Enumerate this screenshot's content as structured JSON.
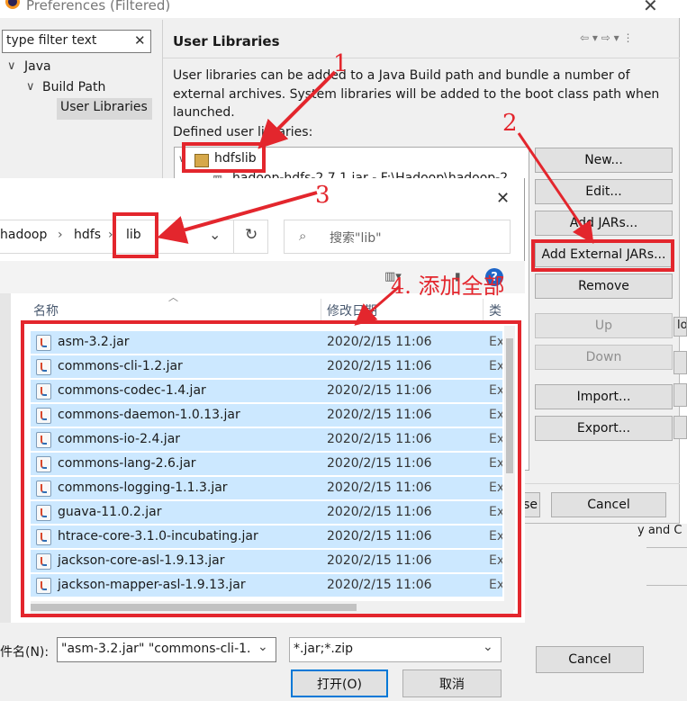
{
  "prefs": {
    "title": "Preferences (Filtered)",
    "filter_placeholder": "type filter text",
    "tree": {
      "java": "Java",
      "build_path": "Build Path",
      "user_libraries": "User Libraries"
    },
    "panel_title": "User Libraries",
    "description": "User libraries can be added to a Java Build path and bundle a number of external archives. System libraries will be added to the boot class path when launched.",
    "defined_label": "Defined user libraries:",
    "library_name": "hdfslib",
    "library_jar": "hadoop-hdfs-2.7.1.jar - F:\\Hadoop\\hadoop-2",
    "buttons": {
      "new": "New...",
      "edit": "Edit...",
      "add_jars": "Add JARs...",
      "add_external_jars": "Add External JARs...",
      "remove": "Remove",
      "up": "Up",
      "down": "Down",
      "import": "Import...",
      "export": "Export...",
      "apply_close_partial": "se",
      "cancel": "Cancel",
      "cancel_bottom": "Cancel"
    }
  },
  "dialog": {
    "breadcrumb": [
      "hadoop",
      "hdfs",
      "lib"
    ],
    "search_placeholder": "搜索\"lib\"",
    "columns": {
      "name": "名称",
      "modified": "修改日期",
      "type": "类"
    },
    "files": [
      {
        "name": "asm-3.2.jar",
        "date": "2020/2/15 11:06",
        "type": "Ex"
      },
      {
        "name": "commons-cli-1.2.jar",
        "date": "2020/2/15 11:06",
        "type": "Ex"
      },
      {
        "name": "commons-codec-1.4.jar",
        "date": "2020/2/15 11:06",
        "type": "Ex"
      },
      {
        "name": "commons-daemon-1.0.13.jar",
        "date": "2020/2/15 11:06",
        "type": "Ex"
      },
      {
        "name": "commons-io-2.4.jar",
        "date": "2020/2/15 11:06",
        "type": "Ex"
      },
      {
        "name": "commons-lang-2.6.jar",
        "date": "2020/2/15 11:06",
        "type": "Ex"
      },
      {
        "name": "commons-logging-1.1.3.jar",
        "date": "2020/2/15 11:06",
        "type": "Ex"
      },
      {
        "name": "guava-11.0.2.jar",
        "date": "2020/2/15 11:06",
        "type": "Ex"
      },
      {
        "name": "htrace-core-3.1.0-incubating.jar",
        "date": "2020/2/15 11:06",
        "type": "Ex"
      },
      {
        "name": "jackson-core-asl-1.9.13.jar",
        "date": "2020/2/15 11:06",
        "type": "Ex"
      },
      {
        "name": "jackson-mapper-asl-1.9.13.jar",
        "date": "2020/2/15 11:06",
        "type": "Ex"
      }
    ],
    "filename_label": "件名(N):",
    "filename_value": "\"asm-3.2.jar\" \"commons-cli-1.",
    "filetype_value": "*.jar;*.zip",
    "open_button": "打开(O)",
    "cancel_button": "取消"
  },
  "annotations": {
    "step1": "1",
    "step2": "2",
    "step3": "3",
    "step4": "4. 添加全部"
  },
  "bg_fragments": {
    "right_lo": "lo",
    "right_and": "y and C"
  },
  "colors": {
    "annotation_red": "#e3262d",
    "selection_blue": "#cce8ff",
    "window_bg": "#f0f0f0"
  }
}
